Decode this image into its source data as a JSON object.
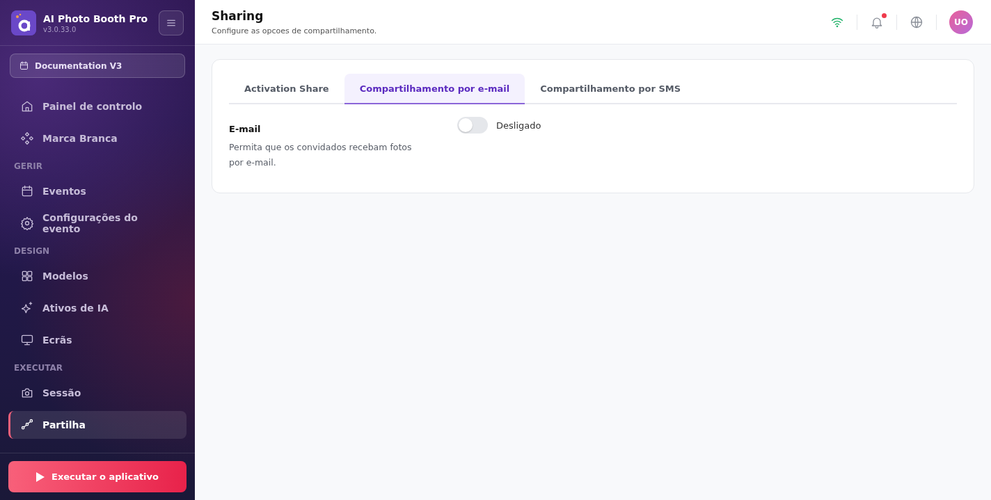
{
  "app": {
    "name": "AI Photo Booth Pro",
    "version": "v3.0.33.0"
  },
  "project": {
    "label": "Documentation V3"
  },
  "sidebar": {
    "items": [
      {
        "kind": "item",
        "label": "Painel de controlo",
        "selected": false
      },
      {
        "kind": "item",
        "label": "Marca Branca",
        "selected": false
      },
      {
        "kind": "section",
        "label": "GERIR"
      },
      {
        "kind": "item",
        "label": "Eventos",
        "selected": false
      },
      {
        "kind": "item",
        "label": "Configurações do evento",
        "selected": false
      },
      {
        "kind": "section",
        "label": "DESIGN"
      },
      {
        "kind": "item",
        "label": "Modelos",
        "selected": false
      },
      {
        "kind": "item",
        "label": "Ativos de IA",
        "selected": false
      },
      {
        "kind": "item",
        "label": "Ecrãs",
        "selected": false
      },
      {
        "kind": "section",
        "label": "EXECUTAR"
      },
      {
        "kind": "item",
        "label": "Sessão",
        "selected": false
      },
      {
        "kind": "item",
        "label": "Partilha",
        "selected": true
      }
    ]
  },
  "run_button": {
    "label": "Executar o aplicativo"
  },
  "header": {
    "title": "Sharing",
    "subtitle": "Configure as opcoes de compartilhamento.",
    "notification": true,
    "avatar": "UO"
  },
  "tabs": [
    {
      "label": "Activation Share",
      "selected": false
    },
    {
      "label": "Compartilhamento por e-mail",
      "selected": true
    },
    {
      "label": "Compartilhamento por SMS",
      "selected": false
    }
  ],
  "setting": {
    "title": "E-mail",
    "description": "Permita que os convidados recebam fotos por e-mail.",
    "on": false,
    "state_label": "Desligado"
  }
}
